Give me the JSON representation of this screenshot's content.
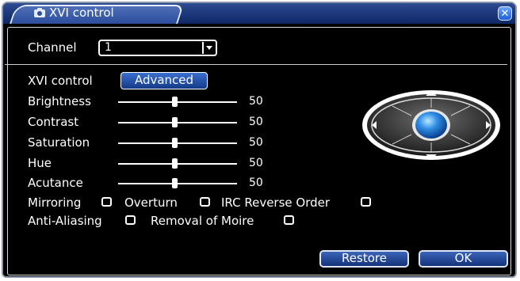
{
  "window": {
    "title": "XVI control",
    "close_symbol": "✕"
  },
  "channel": {
    "label": "Channel",
    "value": "1"
  },
  "xvi": {
    "label": "XVI control",
    "mode_button": "Advanced"
  },
  "sliders": [
    {
      "label": "Brightness",
      "value": "50",
      "fraction": 0.5
    },
    {
      "label": "Contrast",
      "value": "50",
      "fraction": 0.5
    },
    {
      "label": "Saturation",
      "value": "50",
      "fraction": 0.5
    },
    {
      "label": "Hue",
      "value": "50",
      "fraction": 0.5
    },
    {
      "label": "Acutance",
      "value": "50",
      "fraction": 0.5
    }
  ],
  "checkboxes": [
    {
      "label": "Mirroring",
      "checked": false
    },
    {
      "label": "Overturn",
      "checked": false
    },
    {
      "label": "IRC Reverse Order",
      "checked": false
    },
    {
      "label": "Anti-Aliasing",
      "checked": false
    },
    {
      "label": "Removal of Moire",
      "checked": false
    }
  ],
  "footer": {
    "restore_label": "Restore",
    "ok_label": "OK"
  },
  "colors": {
    "background": "#000000",
    "accent": "#1e56c8",
    "text": "#ffffff"
  }
}
